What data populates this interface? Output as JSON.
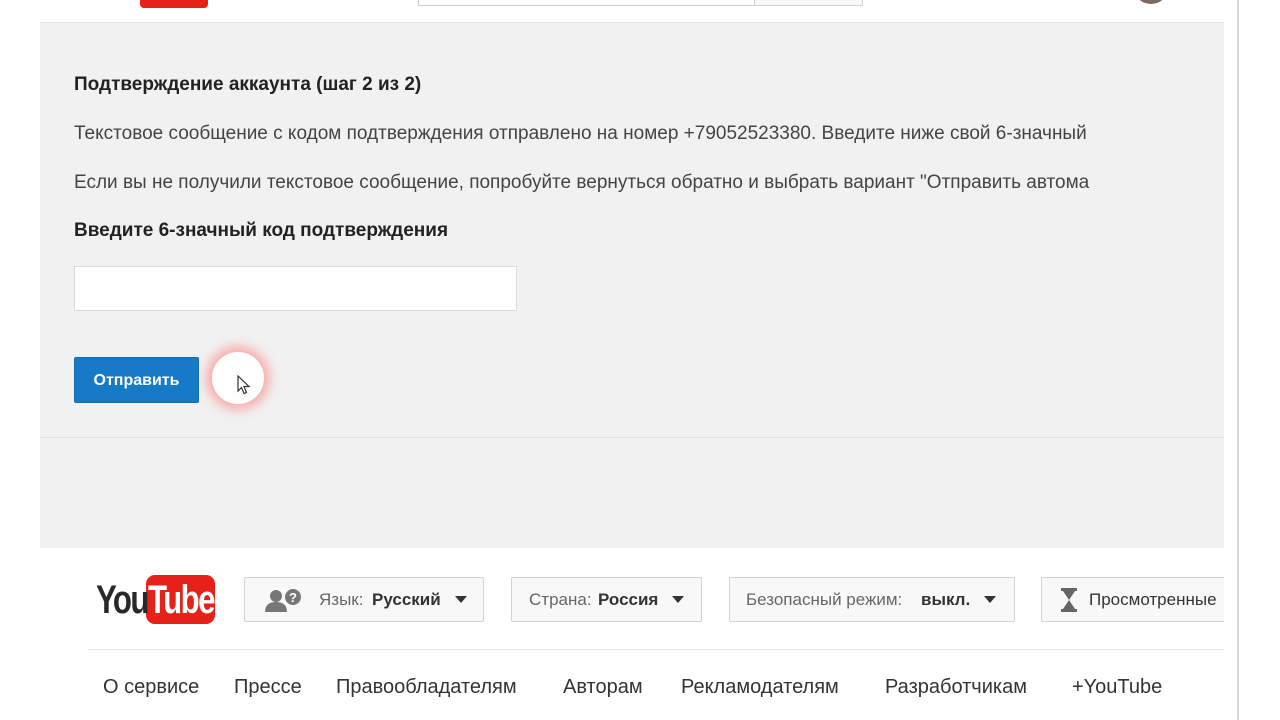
{
  "verification": {
    "title": "Подтверждение аккаунта (шаг 2 из 2)",
    "message_sent": "Текстовое сообщение с кодом подтверждения отправлено на номер +79052523380. Введите ниже свой 6-значный",
    "message_not_received": "Если вы не получили текстовое сообщение, попробуйте вернуться обратно и выбрать вариант \"Отправить автома",
    "code_label": "Введите 6-значный код подтверждения",
    "code_value": "",
    "submit_label": "Отправить"
  },
  "footer": {
    "logo_you": "You",
    "logo_tube": "Tube",
    "language_label": "Язык:",
    "language_value": "Русский",
    "country_label": "Страна:",
    "country_value": "Россия",
    "safe_mode_label": "Безопасный режим:",
    "safe_mode_value": "выкл.",
    "history_label": "Просмотренные",
    "links": [
      "О сервисе",
      "Прессе",
      "Правообладателям",
      "Авторам",
      "Рекламодателям",
      "Разработчикам",
      "+YouTube"
    ]
  },
  "icons": {
    "language": "people-help-icon",
    "history": "hourglass-icon",
    "dropdown": "caret-down-icon",
    "cursor": "mouse-pointer-icon"
  },
  "colors": {
    "primary_button": "#167ac6",
    "youtube_red": "#e62117",
    "page_background": "#f1f1f1"
  }
}
